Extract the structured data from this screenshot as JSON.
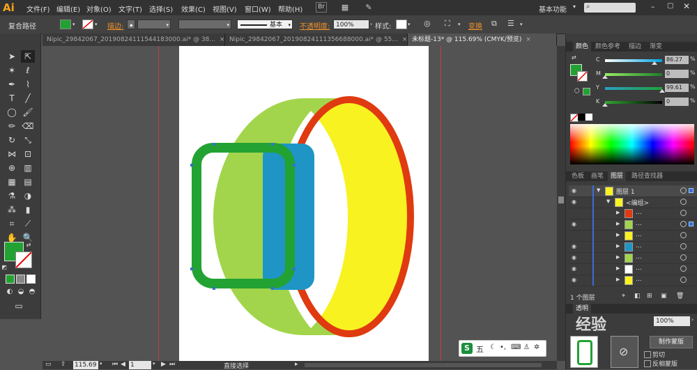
{
  "app": {
    "logo": "Ai"
  },
  "menu": [
    "文件(F)",
    "编辑(E)",
    "对象(O)",
    "文字(T)",
    "选择(S)",
    "效果(C)",
    "视图(V)",
    "窗口(W)",
    "帮助(H)"
  ],
  "workspace": {
    "label": "基本功能",
    "search_placeholder": ""
  },
  "control": {
    "selection_type": "复合路径",
    "fill_color": "#22a233",
    "stroke_label": "描边:",
    "brush_label": "基本",
    "opacity_label": "不透明度:",
    "opacity_value": "100%",
    "style_label": "样式:",
    "transform_label": "变换"
  },
  "tabs": [
    {
      "label": "Nipic_29842067_20190824111544183000.ai* @ 38...",
      "close": "×"
    },
    {
      "label": "Nipic_29842067_20190824111356688000.ai* @ 55...",
      "close": "×"
    },
    {
      "label": "未标题-13* @ 115.69% (CMYK/预览)",
      "close": "×"
    }
  ],
  "status": {
    "zoom": "115.69",
    "page": "1",
    "tool": "直接选择"
  },
  "colors": {
    "yellow": "#f8f221",
    "red": "#e03a10",
    "light_green": "#a2d54c",
    "blue": "#1f95c5",
    "green": "#22a233"
  },
  "color_panel": {
    "tabs": [
      "颜色",
      "颜色参考",
      "描边",
      "渐变"
    ],
    "channels": [
      {
        "name": "C",
        "value": "86.27",
        "unit": "%",
        "fraction": 0.8627,
        "gradient": "linear-gradient(90deg,#fff,#00a5e4)"
      },
      {
        "name": "M",
        "value": "0",
        "unit": "%",
        "fraction": 0,
        "gradient": "linear-gradient(90deg,#9e6,#1b7f2a)"
      },
      {
        "name": "Y",
        "value": "99.61",
        "unit": "%",
        "fraction": 0.9961,
        "gradient": "linear-gradient(90deg,#2aa0c8,#1fa23a)"
      },
      {
        "name": "K",
        "value": "0",
        "unit": "%",
        "fraction": 0,
        "gradient": "linear-gradient(90deg,#3a3,#000)"
      }
    ]
  },
  "layers_panel": {
    "tabs": [
      "色板",
      "画笔",
      "图层",
      "路径查找器"
    ],
    "rows": [
      {
        "name": "图层 1",
        "level": 0,
        "expanded": true,
        "eye": true,
        "thumb": "#f8f221",
        "selected": true
      },
      {
        "name": "<编组>",
        "level": 1,
        "expanded": true,
        "eye": true,
        "thumb": "#f8f221",
        "selected": false
      },
      {
        "name": "...",
        "level": 2,
        "expanded": false,
        "eye": false,
        "thumb": "#e03a10",
        "selected": false
      },
      {
        "name": "...",
        "level": 2,
        "expanded": false,
        "eye": true,
        "thumb": "#a2d54c",
        "selected": true
      },
      {
        "name": "...",
        "level": 2,
        "expanded": false,
        "eye": false,
        "thumb": "#f8f221",
        "selected": false
      },
      {
        "name": "...",
        "level": 2,
        "expanded": false,
        "eye": true,
        "thumb": "#1f95c5",
        "selected": false
      },
      {
        "name": "...",
        "level": 2,
        "expanded": false,
        "eye": true,
        "thumb": "#a2d54c",
        "selected": false
      },
      {
        "name": "...",
        "level": 2,
        "expanded": false,
        "eye": true,
        "thumb": "#ffffff",
        "selected": false
      },
      {
        "name": "...",
        "level": 2,
        "expanded": false,
        "eye": true,
        "thumb": "#f8f221",
        "selected": false
      }
    ],
    "footer": "1 个图层"
  },
  "transparency": {
    "tab": "透明",
    "opacity_value": "100%",
    "make_mask": "制作蒙版",
    "clip": "剪切",
    "invert": "反相蒙版"
  },
  "ime": {
    "label": "五"
  },
  "watermark": "经验"
}
